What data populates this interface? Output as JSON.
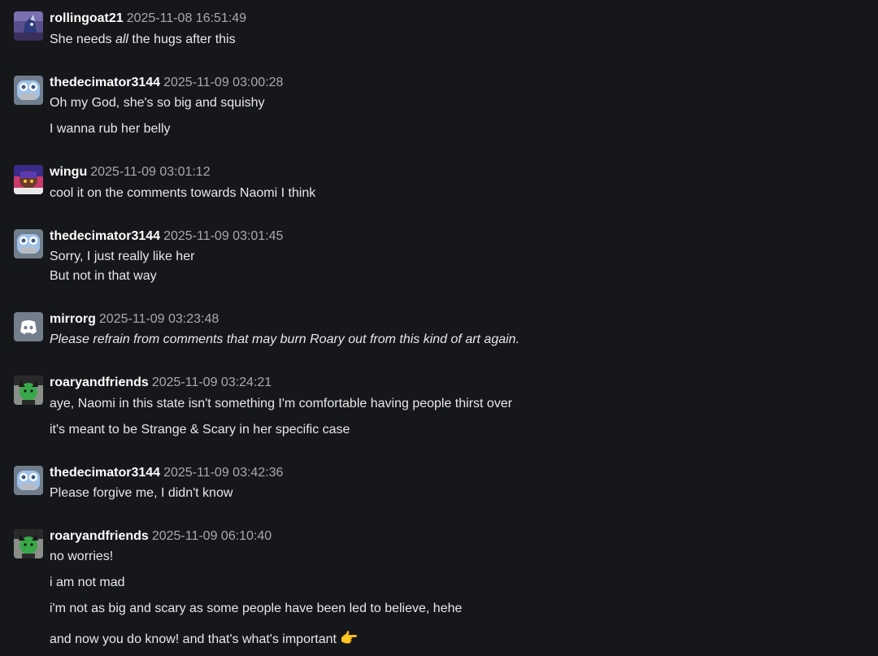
{
  "messages": [
    {
      "author": "rollingoat21",
      "time": "2025-11-08 16:51:49",
      "avatar": "wolf-avatar",
      "lines": [
        {
          "before": "She needs ",
          "em": "all",
          "after": " the hugs after this"
        }
      ]
    },
    {
      "author": "thedecimator3144",
      "time": "2025-11-09 03:00:28",
      "avatar": "robot-avatar",
      "lines": [
        {
          "text": "Oh my God, she's so big and squishy"
        },
        {
          "text": "I wanna rub her belly"
        }
      ]
    },
    {
      "author": "wingu",
      "time": "2025-11-09 03:01:12",
      "avatar": "character-avatar",
      "lines": [
        {
          "text": "cool it on the comments towards Naomi I think"
        }
      ]
    },
    {
      "author": "thedecimator3144",
      "time": "2025-11-09 03:01:45",
      "avatar": "robot-avatar",
      "lines": [
        {
          "text": "Sorry, I just really like her"
        },
        {
          "text": "But not in that way"
        }
      ]
    },
    {
      "author": "mirrorg",
      "time": "2025-11-09 03:23:48",
      "avatar": "discord-avatar",
      "lines": [
        {
          "text": "Please refrain from comments that may burn Roary out from this kind of art again.",
          "italic": true
        }
      ]
    },
    {
      "author": "roaryandfriends",
      "time": "2025-11-09 03:24:21",
      "avatar": "green-character-avatar",
      "lines": [
        {
          "text": "aye, Naomi in this state isn't something I'm comfortable having people thirst over"
        },
        {
          "text": "it's meant to be Strange & Scary in her specific case"
        }
      ]
    },
    {
      "author": "thedecimator3144",
      "time": "2025-11-09 03:42:36",
      "avatar": "robot-avatar",
      "lines": [
        {
          "text": "Please forgive me, I didn't know"
        }
      ]
    },
    {
      "author": "roaryandfriends",
      "time": "2025-11-09 06:10:40",
      "avatar": "green-character-avatar",
      "lines": [
        {
          "text": "no worries!"
        },
        {
          "text": "i am not mad"
        },
        {
          "text": "i'm not as big and scary as some people have been led to believe, hehe"
        },
        {
          "text": "and now you do know! and that's what's important",
          "emoji": "👉"
        }
      ]
    }
  ],
  "colors": {
    "background": "#16171a",
    "username": "#ffffff",
    "timestamp": "#a8a9ad",
    "text": "#e8e8ea"
  }
}
